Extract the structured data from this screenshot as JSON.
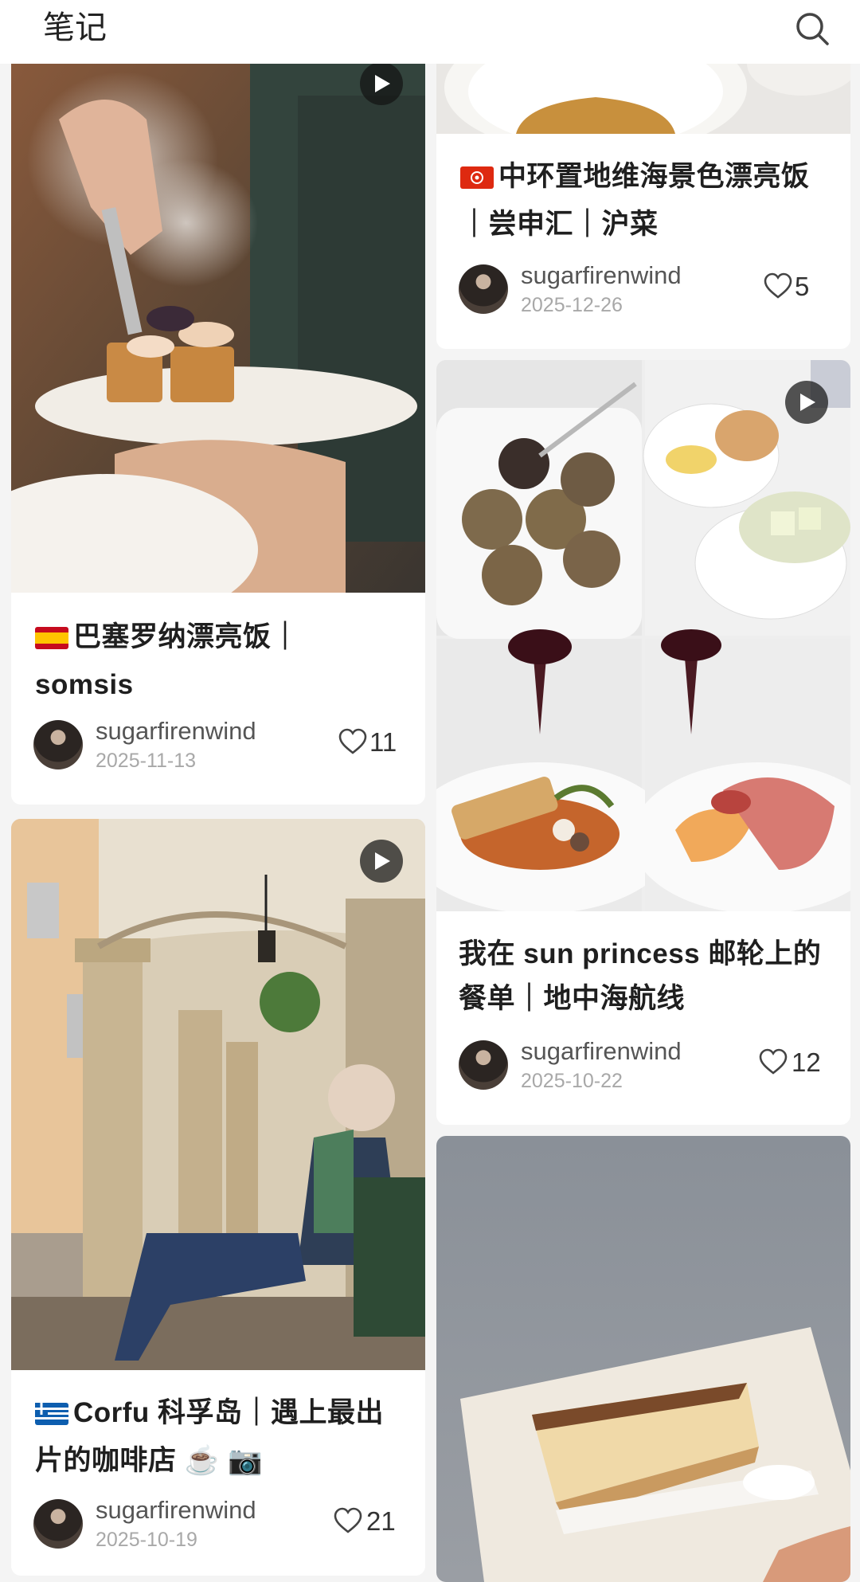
{
  "header": {
    "title": "笔记",
    "search_icon": "search-icon"
  },
  "cards": [
    {
      "title_line1": "巴塞罗纳漂亮饭｜",
      "title_line2": "somsis",
      "flag_icon": "spain-flag-icon",
      "author": "sugarfirenwind",
      "date": "2025-11-13",
      "likes": "11",
      "video": true
    },
    {
      "title_line1": "中环置地维海景色漂亮饭",
      "title_line2": "｜尝申汇｜沪菜",
      "flag_icon": "hong-kong-flag-icon",
      "author": "sugarfirenwind",
      "date": "2025-12-26",
      "likes": "5",
      "video": false
    },
    {
      "title_line1": "我在 sun princess 邮轮上的",
      "title_line2": "餐单｜地中海航线",
      "author": "sugarfirenwind",
      "date": "2025-10-22",
      "likes": "12",
      "video": true
    },
    {
      "title_line1": "Corfu 科孚岛｜遇上最出",
      "title_line2": "片的咖啡店",
      "title_emoji": "☕️ 📷",
      "flag_icon": "greece-flag-icon",
      "author": "sugarfirenwind",
      "date": "2025-10-19",
      "likes": "21",
      "video": true
    },
    {
      "video": false
    }
  ],
  "colors": {
    "background": "#f4f4f4",
    "card": "#ffffff",
    "text": "#1f1f1f",
    "secondary": "#a8a8a8"
  }
}
